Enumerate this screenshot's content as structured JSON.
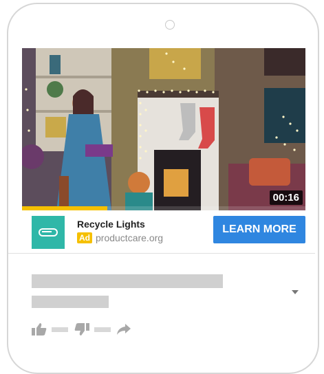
{
  "video": {
    "duration": "00:16",
    "progress_fraction": 0.3
  },
  "ad": {
    "title": "Recycle Lights",
    "badge": "Ad",
    "domain": "productcare.org",
    "cta": "LEARN MORE",
    "brand_color": "#2fb7a8",
    "cta_color": "#2f86e0",
    "badge_color": "#f5c000"
  },
  "icons": {
    "like": "thumbs-up-icon",
    "dislike": "thumbs-down-icon",
    "share": "share-arrow-icon",
    "expand": "chevron-down-icon"
  }
}
